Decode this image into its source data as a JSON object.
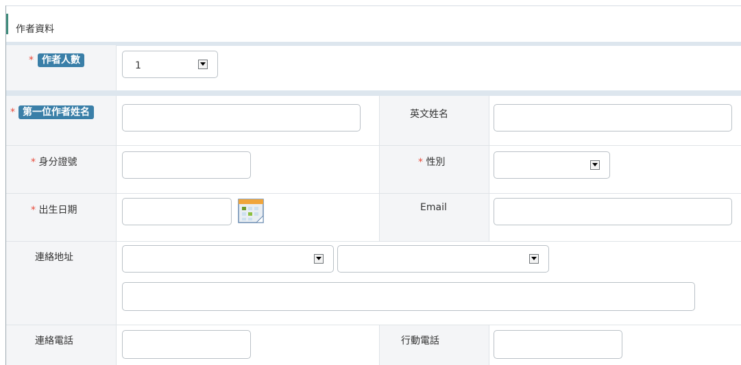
{
  "section": {
    "title": "作者資料"
  },
  "author_count": {
    "required_mark": "*",
    "label": "作者人數",
    "selected": "1"
  },
  "first_author": {
    "required_mark": "*",
    "label": "第一位作者姓名",
    "value": ""
  },
  "english_name": {
    "label": "英文姓名",
    "value": ""
  },
  "id_number": {
    "required_mark": "*",
    "label": "身分證號",
    "value": ""
  },
  "gender": {
    "required_mark": "*",
    "label": "性別",
    "selected": ""
  },
  "birth_date": {
    "required_mark": "*",
    "label": "出生日期",
    "value": "",
    "icon": "calendar-icon"
  },
  "email": {
    "label": "Email",
    "value": ""
  },
  "address": {
    "label": "連絡地址",
    "city_selected": "",
    "district_selected": "",
    "street_value": ""
  },
  "phone": {
    "label": "連絡電話",
    "value": ""
  },
  "mobile": {
    "label": "行動電話",
    "value": ""
  },
  "colors": {
    "badge": "#3a7fa8",
    "required": "#e74c3c",
    "accent": "#3f8b7b",
    "strip": "#dde6ee"
  }
}
